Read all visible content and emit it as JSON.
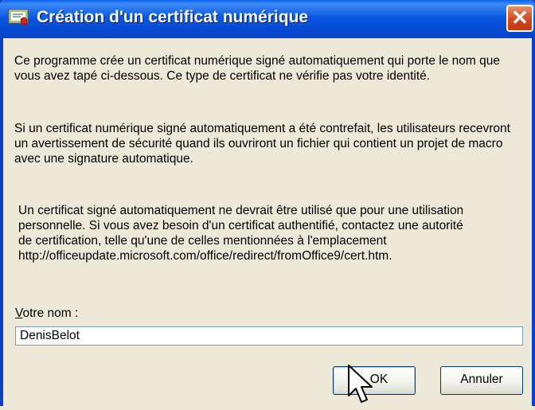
{
  "window": {
    "title": "Création d'un certificat numérique",
    "close_symbol": "✕"
  },
  "message": {
    "paragraph1": "Ce programme crée un certificat numérique signé automatiquement qui porte le nom que vous avez tapé ci-dessous. Ce type de certificat ne vérifie pas votre identité.",
    "paragraph2": "Si un certificat numérique signé automatiquement a été contrefait, les utilisateurs recevront un avertissement de sécurité quand ils ouvriront un fichier qui contient un projet de macro avec une signature automatique.",
    "paragraph3_line1": "Un certificat signé automatiquement ne devrait être utilisé que pour une utilisation",
    "paragraph3_line2": "personnelle. Si vous avez besoin d'un certificat authentifié, contactez une autorité",
    "paragraph3_line3": "de certification, telle qu'une de celles mentionnées à l'emplacement",
    "paragraph3_line4": "http://officeupdate.microsoft.com/office/redirect/fromOffice9/cert.htm."
  },
  "form": {
    "name_label_accel": "V",
    "name_label_rest": "otre nom :",
    "name_value": "DenisBelot"
  },
  "buttons": {
    "ok": "OK",
    "cancel": "Annuler"
  },
  "icons": {
    "app": "certificate-icon",
    "close": "close-icon",
    "cursor": "arrow-cursor-icon"
  },
  "colors": {
    "titlebar": "#0a57e0",
    "face": "#ece9d8",
    "close": "#d4461e"
  }
}
